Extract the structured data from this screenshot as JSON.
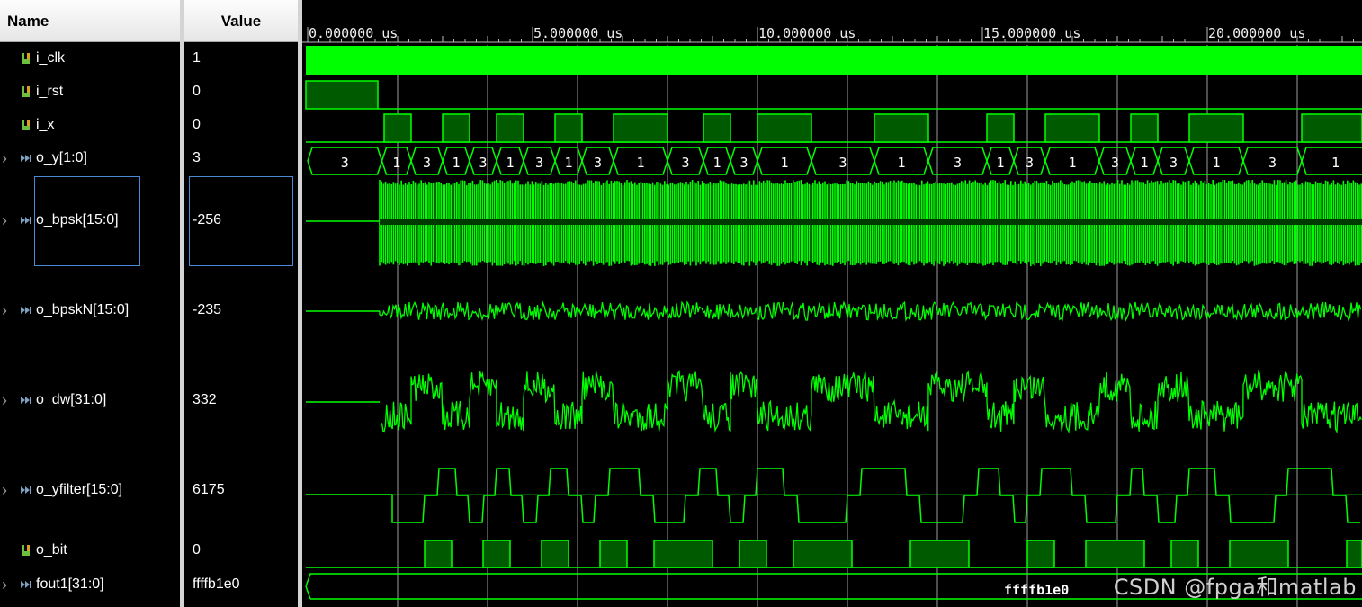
{
  "columns": {
    "name": "Name",
    "value": "Value"
  },
  "signals": [
    {
      "name": "i_clk",
      "value": "1",
      "kind": "bit",
      "expandable": false
    },
    {
      "name": "i_rst",
      "value": "0",
      "kind": "bit",
      "expandable": false
    },
    {
      "name": "i_x",
      "value": "0",
      "kind": "bit",
      "expandable": false
    },
    {
      "name": "o_y[1:0]",
      "value": "3",
      "kind": "bus",
      "expandable": true
    },
    {
      "name": "o_bpsk[15:0]",
      "value": "-256",
      "kind": "bus",
      "expandable": true
    },
    {
      "name": "o_bpskN[15:0]",
      "value": "-235",
      "kind": "bus",
      "expandable": true
    },
    {
      "name": "o_dw[31:0]",
      "value": "332",
      "kind": "bus",
      "expandable": true
    },
    {
      "name": "o_yfilter[15:0]",
      "value": "6175",
      "kind": "bus",
      "expandable": true
    },
    {
      "name": "o_bit",
      "value": "0",
      "kind": "bit",
      "expandable": false
    },
    {
      "name": "fout1[31:0]",
      "value": "ffffb1e0",
      "kind": "bus",
      "expandable": true
    }
  ],
  "timeline": {
    "labels": [
      "0.000000 us",
      "5.000000 us",
      "10.000000 us",
      "15.000000 us",
      "20.000000 us"
    ]
  },
  "o_y_segments": [
    "3",
    "1",
    "3",
    "1",
    "3",
    "1",
    "3",
    "1",
    "3",
    "1",
    "3",
    "1",
    "3",
    "1",
    "3",
    "1",
    "3",
    "1",
    "3",
    "1",
    "3",
    "1",
    "3",
    "1",
    "3",
    "1"
  ],
  "fout1_label": "ffffb1e0",
  "colors": {
    "wave": "#00ff00",
    "wave_fill": "#005a00",
    "grid": "#d0d0d0",
    "icon_bit": "#6fbf3f",
    "icon_bus": "#7f9fbf"
  },
  "watermark": "CSDN @fpga和matlab"
}
